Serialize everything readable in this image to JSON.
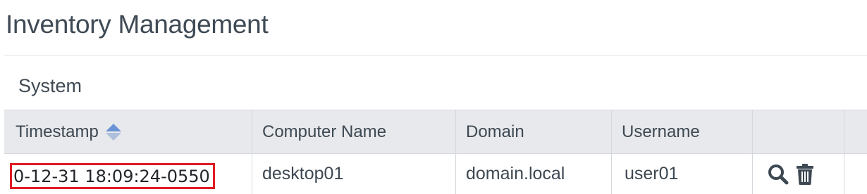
{
  "page": {
    "title": "Inventory Management"
  },
  "section": {
    "title": "System"
  },
  "table": {
    "columns": [
      "Timestamp",
      "Computer Name",
      "Domain",
      "Username",
      ""
    ],
    "sort": {
      "column": "Timestamp",
      "icon": "sort-icon"
    },
    "rows": [
      {
        "timestamp": "0-12-31 18:09:24-0550",
        "computer_name": "desktop01",
        "domain": "domain.local",
        "username": "user01",
        "actions": [
          "search-icon",
          "trash-icon"
        ]
      }
    ]
  },
  "colors": {
    "header_bg": "#e8e9ec",
    "highlight": "#e01b24",
    "sort_active": "#6a93d6",
    "sort_inactive": "#aebfd9",
    "icon": "#3d4852"
  }
}
